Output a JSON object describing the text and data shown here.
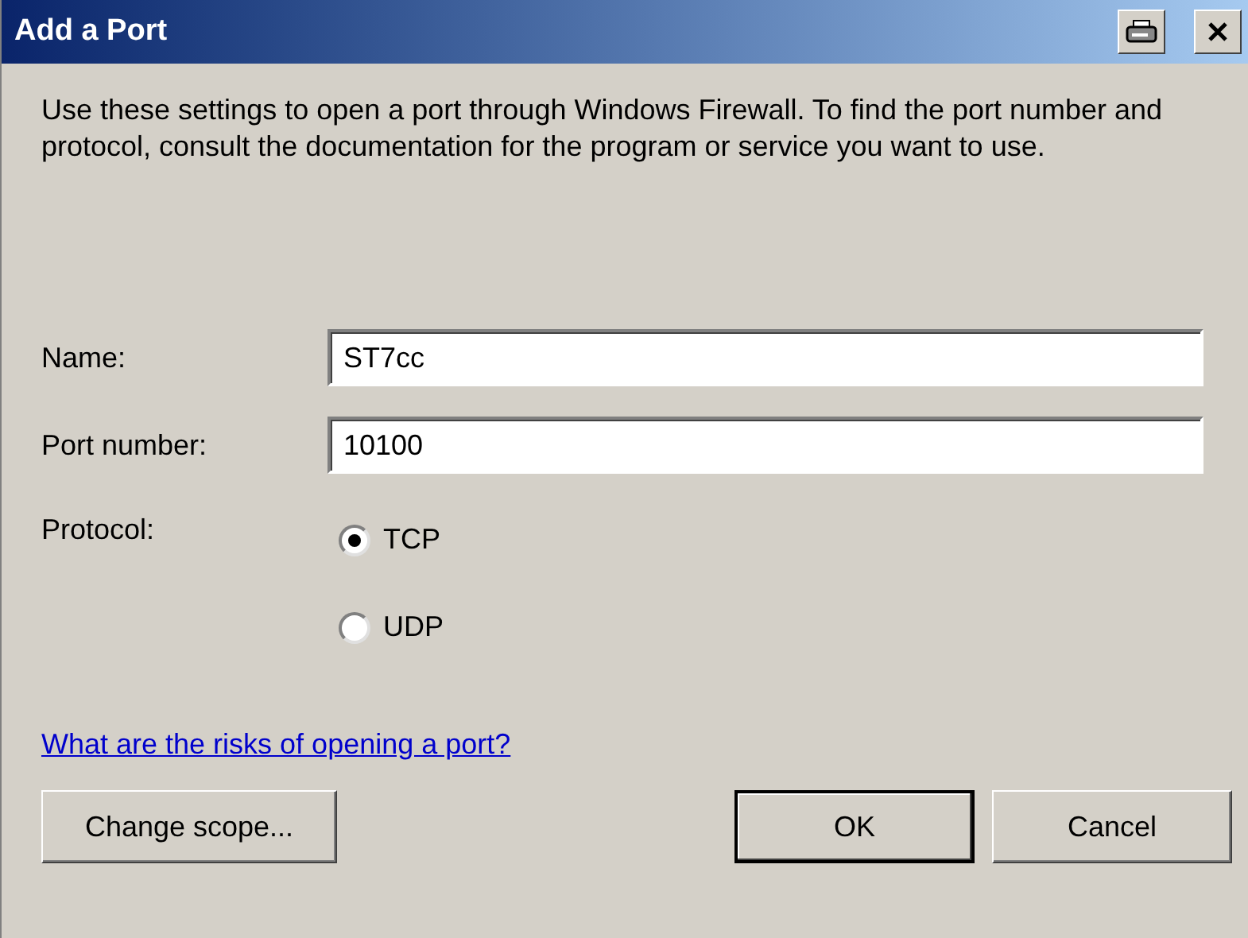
{
  "window": {
    "title": "Add a Port"
  },
  "description": "Use these settings to open a port through Windows Firewall. To find the port number and protocol, consult the documentation for the program or service you want to use.",
  "fields": [
    {
      "label": "Name:",
      "value": "ST7cc"
    },
    {
      "label": "Port number:",
      "value": "10100"
    }
  ],
  "protocol": {
    "label": "Protocol:",
    "options": [
      {
        "label": "TCP",
        "selected": true
      },
      {
        "label": "UDP",
        "selected": false
      }
    ]
  },
  "link": "What are the risks of opening a port?",
  "buttons": [
    {
      "label": "Change scope...",
      "default": false
    },
    {
      "label": "OK",
      "default": true
    },
    {
      "label": "Cancel",
      "default": false
    }
  ]
}
